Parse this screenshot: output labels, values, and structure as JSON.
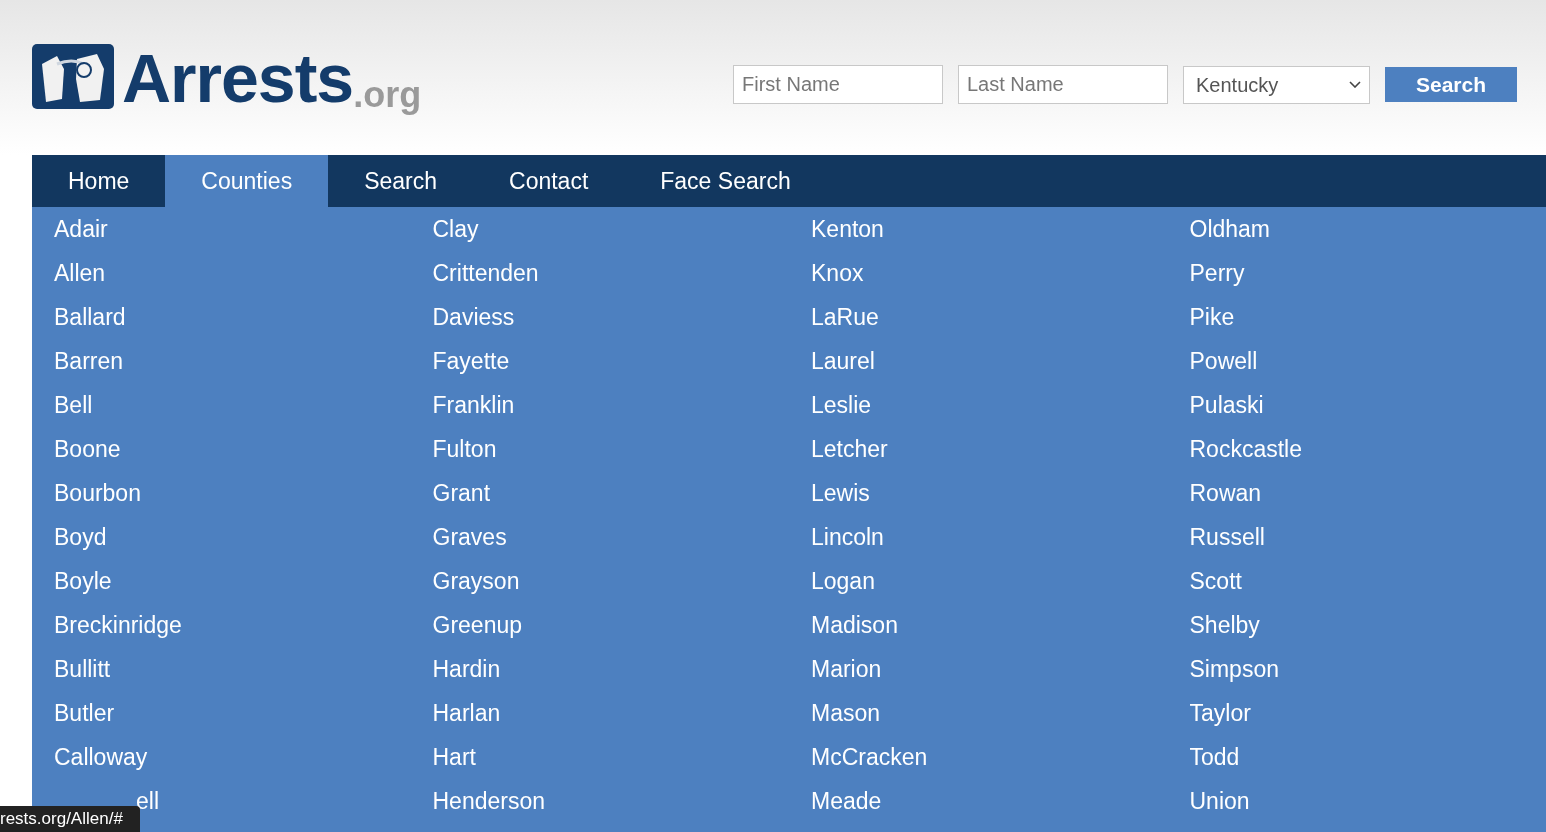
{
  "logo": {
    "name": "Arrests",
    "suffix": ".org"
  },
  "search_form": {
    "first_name": {
      "placeholder": "First Name"
    },
    "last_name": {
      "placeholder": "Last Name"
    },
    "state": {
      "value": "Kentucky"
    },
    "button": "Search"
  },
  "nav": [
    {
      "label": "Home",
      "selected": false
    },
    {
      "label": "Counties",
      "selected": true
    },
    {
      "label": "Search",
      "selected": false
    },
    {
      "label": "Contact",
      "selected": false
    },
    {
      "label": "Face Search",
      "selected": false
    }
  ],
  "counties": [
    [
      {
        "name": "Adair"
      },
      {
        "name": "Allen"
      },
      {
        "name": "Ballard"
      },
      {
        "name": "Barren"
      },
      {
        "name": "Bell"
      },
      {
        "name": "Boone"
      },
      {
        "name": "Bourbon"
      },
      {
        "name": "Boyd"
      },
      {
        "name": "Boyle"
      },
      {
        "name": "Breckinridge"
      },
      {
        "name": "Bullitt"
      },
      {
        "name": "Butler"
      },
      {
        "name": "Calloway"
      },
      {
        "name": "ell",
        "covered": true
      }
    ],
    [
      {
        "name": "Clay"
      },
      {
        "name": "Crittenden"
      },
      {
        "name": "Daviess"
      },
      {
        "name": "Fayette"
      },
      {
        "name": "Franklin"
      },
      {
        "name": "Fulton"
      },
      {
        "name": "Grant"
      },
      {
        "name": "Graves"
      },
      {
        "name": "Grayson"
      },
      {
        "name": "Greenup"
      },
      {
        "name": "Hardin"
      },
      {
        "name": "Harlan"
      },
      {
        "name": "Hart"
      },
      {
        "name": "Henderson"
      }
    ],
    [
      {
        "name": "Kenton"
      },
      {
        "name": "Knox"
      },
      {
        "name": "LaRue"
      },
      {
        "name": "Laurel"
      },
      {
        "name": "Leslie"
      },
      {
        "name": "Letcher"
      },
      {
        "name": "Lewis"
      },
      {
        "name": "Lincoln"
      },
      {
        "name": "Logan"
      },
      {
        "name": "Madison"
      },
      {
        "name": "Marion"
      },
      {
        "name": "Mason"
      },
      {
        "name": "McCracken"
      },
      {
        "name": "Meade"
      }
    ],
    [
      {
        "name": "Oldham"
      },
      {
        "name": "Perry"
      },
      {
        "name": "Pike"
      },
      {
        "name": "Powell"
      },
      {
        "name": "Pulaski"
      },
      {
        "name": "Rockcastle"
      },
      {
        "name": "Rowan"
      },
      {
        "name": "Russell"
      },
      {
        "name": "Scott"
      },
      {
        "name": "Shelby"
      },
      {
        "name": "Simpson"
      },
      {
        "name": "Taylor"
      },
      {
        "name": "Todd"
      },
      {
        "name": "Union"
      }
    ]
  ],
  "status_url": "rests.org/Allen/#"
}
